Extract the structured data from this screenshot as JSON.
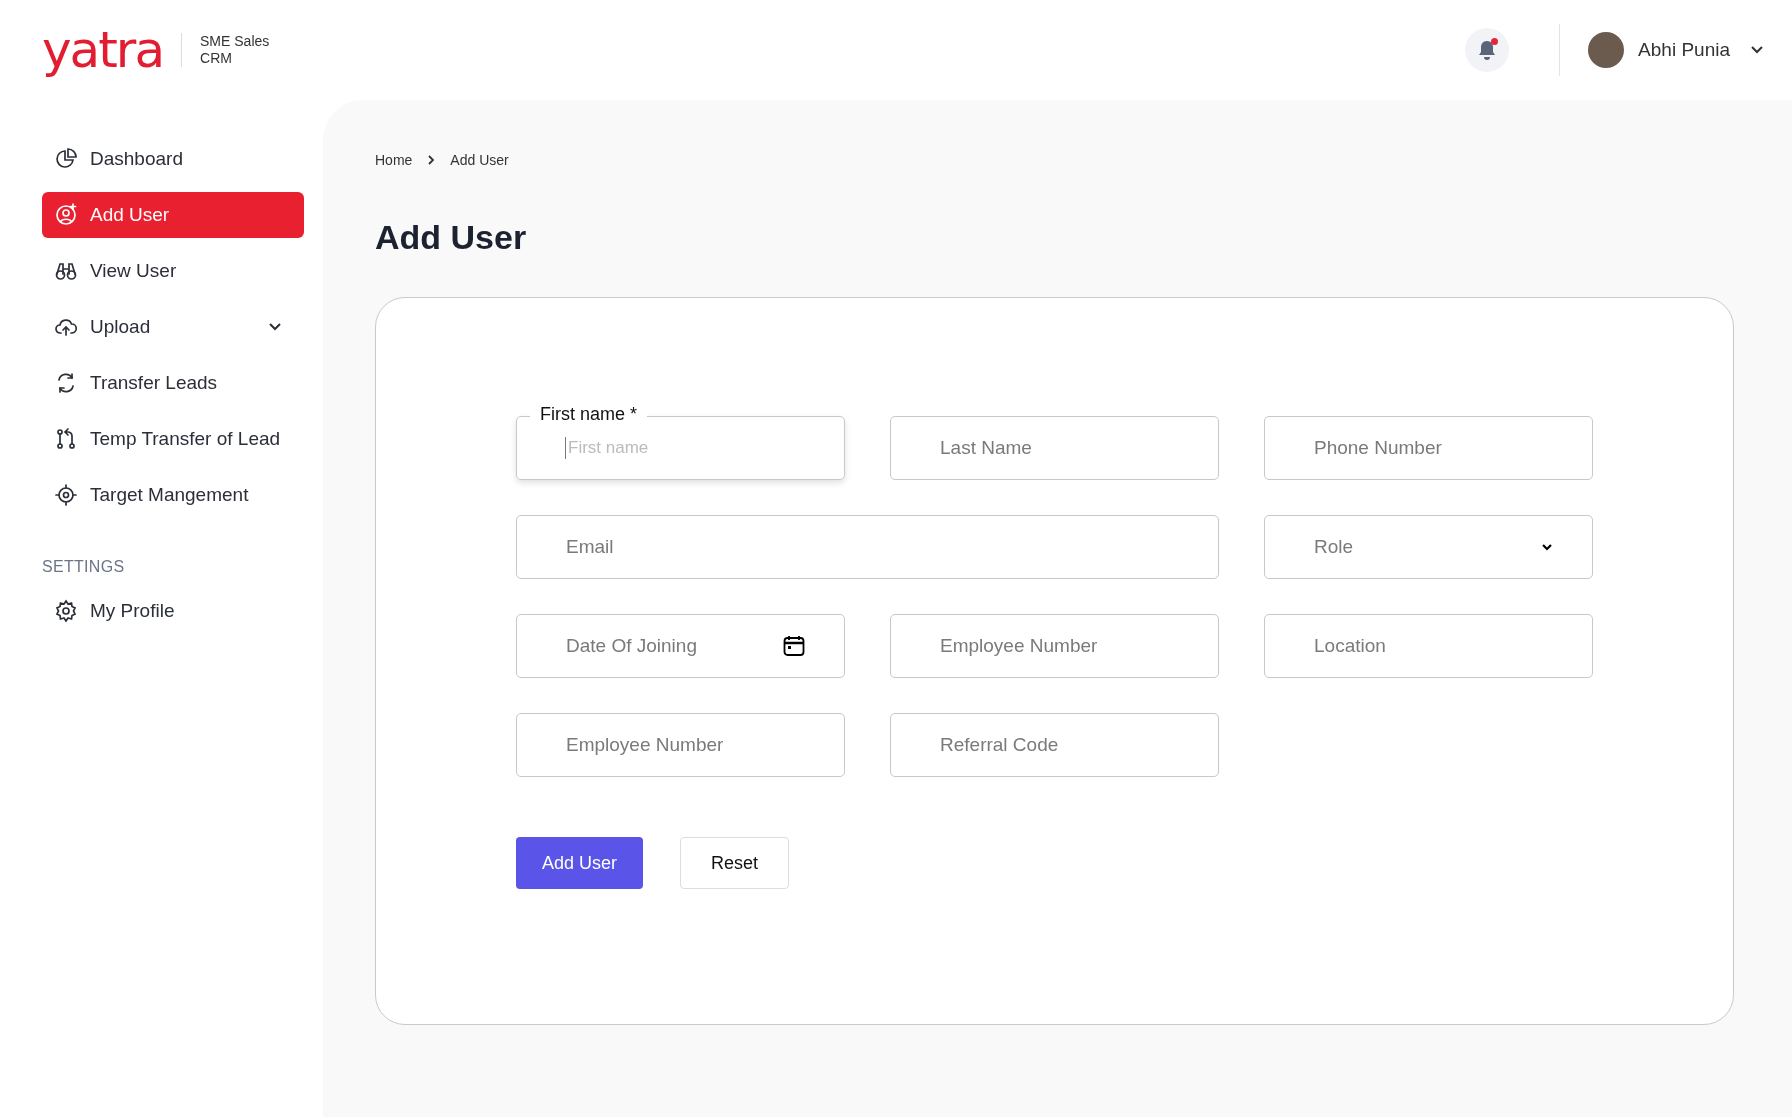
{
  "brand": {
    "logo": "yatra",
    "subtitle_line1": "SME Sales",
    "subtitle_line2": "CRM"
  },
  "header": {
    "notifications": {
      "unread": true
    },
    "user": {
      "name": "Abhi Punia"
    }
  },
  "sidebar": {
    "items": [
      {
        "label": "Dashboard",
        "selected": false,
        "expandable": false
      },
      {
        "label": "Add User",
        "selected": true,
        "expandable": false
      },
      {
        "label": "View User",
        "selected": false,
        "expandable": false
      },
      {
        "label": "Upload",
        "selected": false,
        "expandable": true
      },
      {
        "label": "Transfer Leads",
        "selected": false,
        "expandable": false
      },
      {
        "label": "Temp Transfer of Lead",
        "selected": false,
        "expandable": false
      },
      {
        "label": "Target Mangement",
        "selected": false,
        "expandable": false
      }
    ],
    "section": "SETTINGS",
    "settings_items": [
      {
        "label": "My Profile",
        "selected": false,
        "expandable": false
      }
    ]
  },
  "breadcrumb": [
    "Home",
    "Add User"
  ],
  "page_title": "Add User",
  "form": {
    "fields": [
      {
        "kind": "text",
        "label": "First name *",
        "placeholder": "First name",
        "focused": true
      },
      {
        "kind": "text",
        "placeholder": "Last Name",
        "focused": false
      },
      {
        "kind": "text",
        "placeholder": "Phone Number",
        "focused": false
      },
      {
        "kind": "email",
        "placeholder": "Email",
        "focused": false
      },
      {
        "kind": "select",
        "placeholder": "Role",
        "focused": false
      },
      {
        "kind": "date",
        "placeholder": "Date Of Joining",
        "focused": false
      },
      {
        "kind": "text",
        "placeholder": "Employee Number",
        "focused": false
      },
      {
        "kind": "text",
        "placeholder": "Location",
        "focused": false
      },
      {
        "kind": "text",
        "placeholder": "Employee Number",
        "focused": false
      },
      {
        "kind": "text",
        "placeholder": "Referral Code",
        "focused": false
      }
    ],
    "buttons": [
      {
        "label": "Add User",
        "kind": "primary"
      },
      {
        "label": "Reset",
        "kind": "secondary"
      }
    ]
  }
}
